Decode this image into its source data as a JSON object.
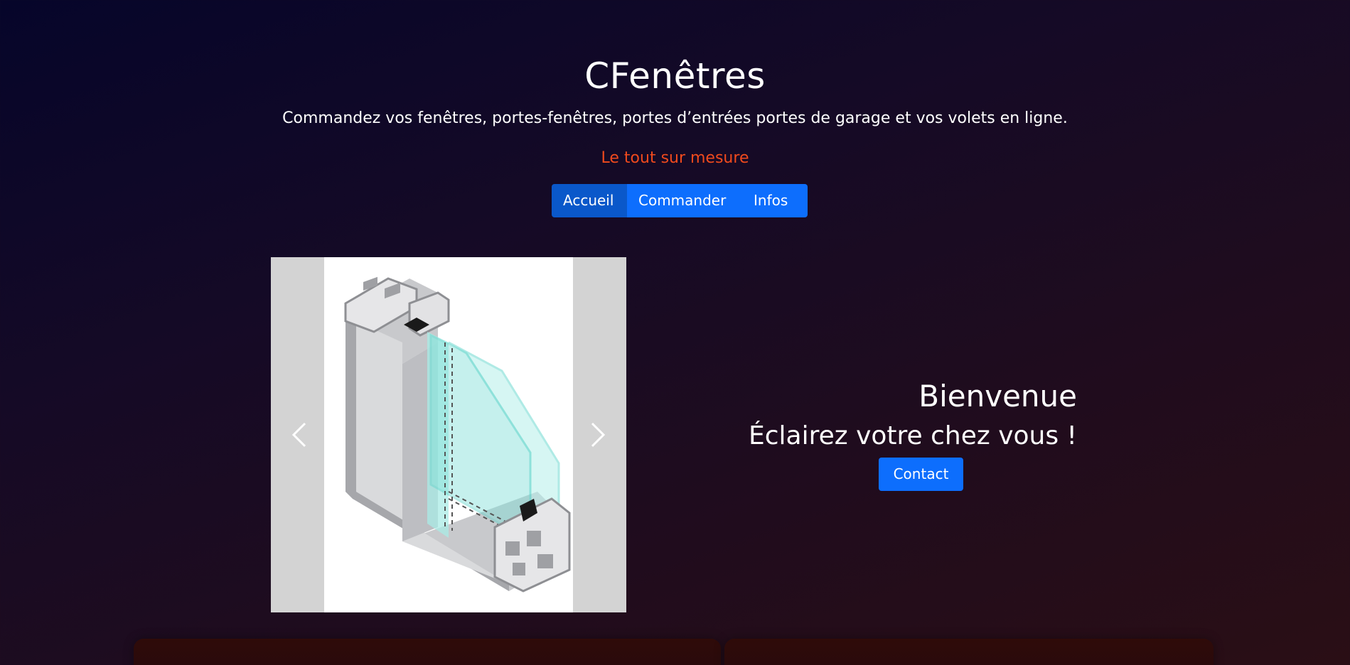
{
  "header": {
    "title": "CFenêtres",
    "subtitle": "Commandez vos fenêtres, portes-fenêtres, portes d’entrées portes de garage et vos volets en ligne.",
    "tagline": "Le tout sur mesure",
    "tagline_color": "#f04a1d"
  },
  "nav": {
    "items": [
      {
        "label": "Accueil",
        "active": true
      },
      {
        "label": "Commander",
        "active": false
      },
      {
        "label": "Infos",
        "active": false
      }
    ],
    "accent": "#0d6efd"
  },
  "carousel": {
    "image": "pvc-window-profile-cross-section",
    "prev_icon": "chevron-left-icon",
    "next_icon": "chevron-right-icon"
  },
  "hero": {
    "heading": "Bienvenue",
    "subheading": "Éclairez votre chez vous !",
    "contact_label": "Contact"
  }
}
